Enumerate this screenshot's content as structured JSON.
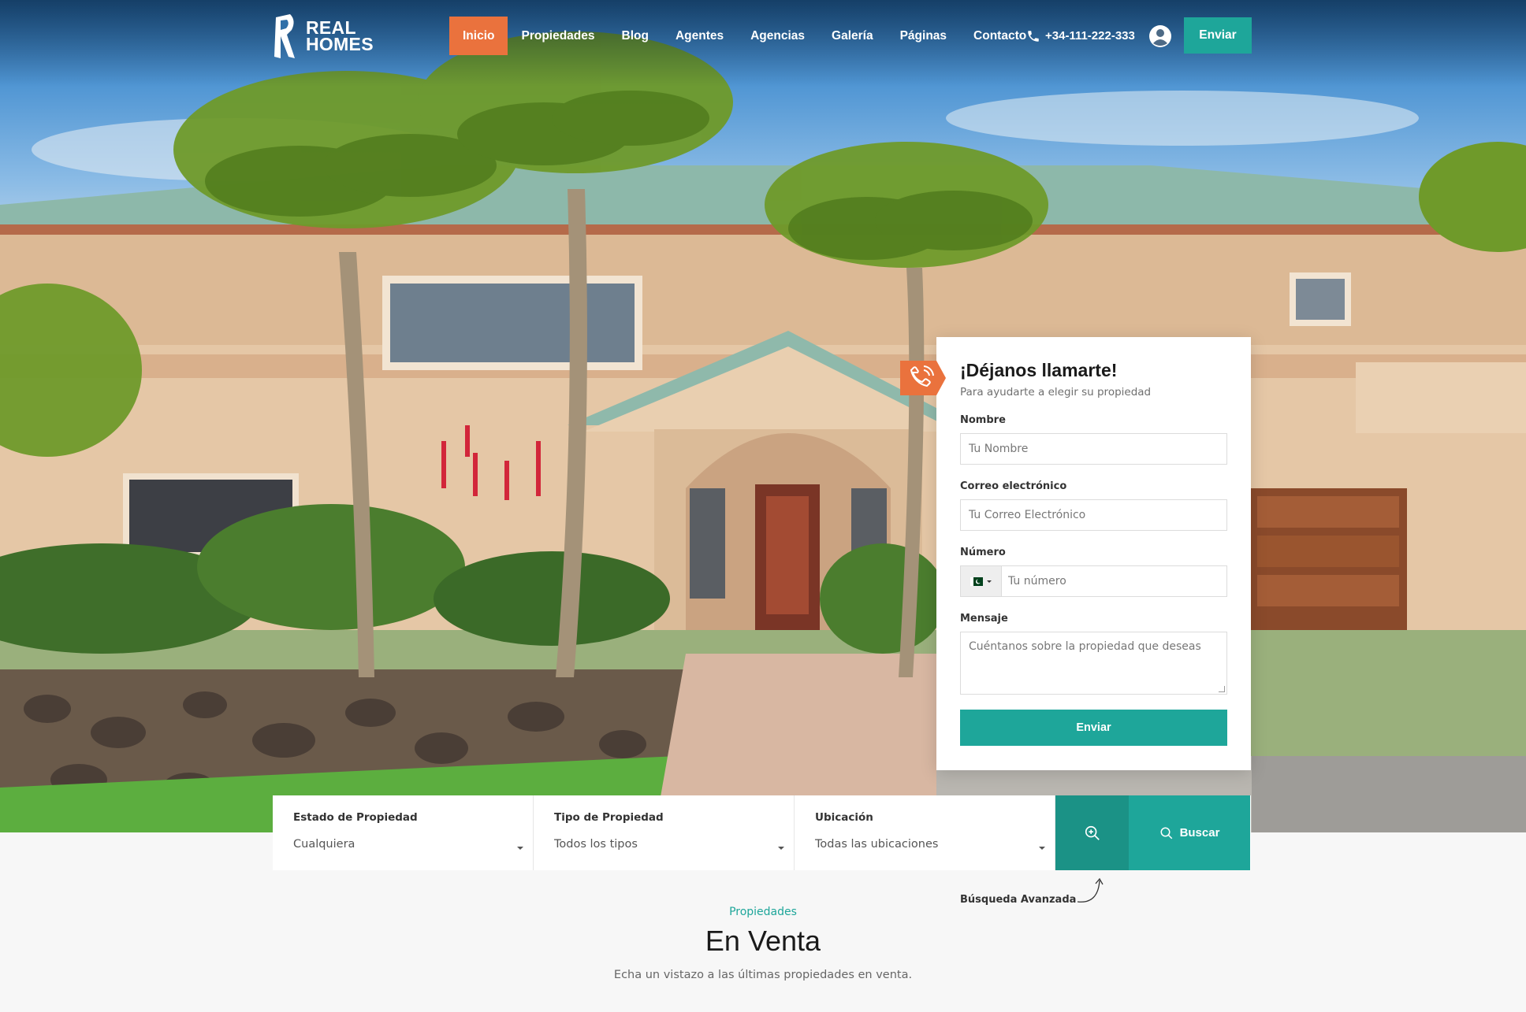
{
  "brand": {
    "line1": "REAL",
    "line2": "HOMES"
  },
  "nav": {
    "items": [
      {
        "label": "Inicio",
        "active": true
      },
      {
        "label": "Propiedades"
      },
      {
        "label": "Blog"
      },
      {
        "label": "Agentes"
      },
      {
        "label": "Agencias"
      },
      {
        "label": "Galería"
      },
      {
        "label": "Páginas"
      },
      {
        "label": "Contacto"
      }
    ],
    "phone": "+34-111-222-333",
    "submit_label": "Enviar"
  },
  "callback_form": {
    "title": "¡Déjanos llamarte!",
    "subtitle": "Para ayudarte a elegir su propiedad",
    "name_label": "Nombre",
    "name_placeholder": "Tu Nombre",
    "email_label": "Correo electrónico",
    "email_placeholder": "Tu Correo Electrónico",
    "number_label": "Número",
    "number_placeholder": "Tu número",
    "message_label": "Mensaje",
    "message_placeholder": "Cuéntanos sobre la propiedad que deseas",
    "send_label": "Enviar"
  },
  "search": {
    "fields": [
      {
        "label": "Estado de Propiedad",
        "value": "Cualquiera"
      },
      {
        "label": "Tipo de Propiedad",
        "value": "Todos los tipos"
      },
      {
        "label": "Ubicación",
        "value": "Todas las ubicaciones"
      }
    ],
    "search_label": "Buscar",
    "advanced_note": "Búsqueda Avanzada"
  },
  "section": {
    "eyebrow": "Propiedades",
    "title": "En Venta",
    "description": "Echa un vistazo a las últimas propiedades en venta."
  },
  "colors": {
    "accent": "#1ea69a",
    "accent_dark": "#1b9286",
    "active_nav": "#ea723d"
  }
}
